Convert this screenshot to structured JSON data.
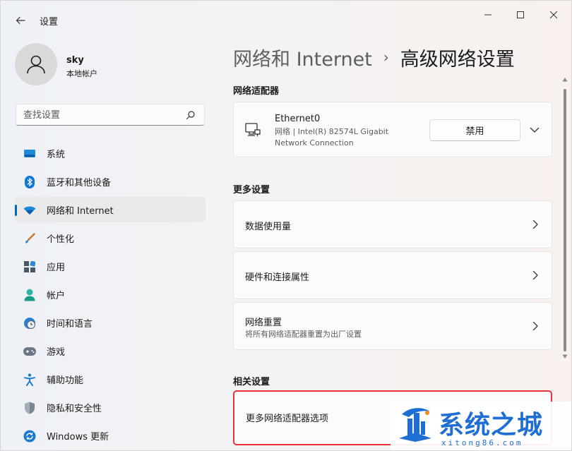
{
  "window": {
    "title": "设置"
  },
  "user": {
    "name": "sky",
    "type": "本地帐户"
  },
  "search": {
    "placeholder": "查找设置"
  },
  "sidebar": {
    "items": [
      {
        "label": "系统",
        "icon": "monitor-icon"
      },
      {
        "label": "蓝牙和其他设备",
        "icon": "bluetooth-icon"
      },
      {
        "label": "网络和 Internet",
        "icon": "wifi-icon",
        "active": true
      },
      {
        "label": "个性化",
        "icon": "brush-icon"
      },
      {
        "label": "应用",
        "icon": "apps-icon"
      },
      {
        "label": "帐户",
        "icon": "person-icon"
      },
      {
        "label": "时间和语言",
        "icon": "clock-globe-icon"
      },
      {
        "label": "游戏",
        "icon": "gamepad-icon"
      },
      {
        "label": "辅助功能",
        "icon": "accessibility-icon"
      },
      {
        "label": "隐私和安全性",
        "icon": "shield-icon"
      },
      {
        "label": "Windows 更新",
        "icon": "update-icon"
      }
    ]
  },
  "breadcrumb": {
    "parent": "网络和 Internet",
    "separator": "›",
    "current": "高级网络设置"
  },
  "adapters": {
    "section_title": "网络适配器",
    "items": [
      {
        "name": "Ethernet0",
        "description": "网络 | Intel(R) 82574L Gigabit Network Connection",
        "button_label": "禁用"
      }
    ]
  },
  "more_settings": {
    "section_title": "更多设置",
    "items": [
      {
        "title": "数据使用量",
        "subtitle": ""
      },
      {
        "title": "硬件和连接属性",
        "subtitle": ""
      },
      {
        "title": "网络重置",
        "subtitle": "将所有网络适配器重置为出厂设置"
      }
    ]
  },
  "related_settings": {
    "section_title": "相关设置",
    "items": [
      {
        "title": "更多网络适配器选项"
      }
    ]
  },
  "watermark": {
    "title": "系统之城",
    "url": "xitong86.com"
  },
  "colors": {
    "accent": "#0067c0",
    "highlight_border": "#e8323a",
    "watermark": "#1f6ed4"
  }
}
